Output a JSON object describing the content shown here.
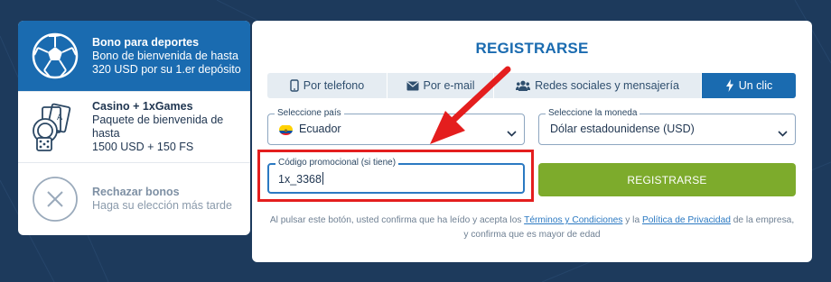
{
  "bonuses": {
    "sports": {
      "title": "Bono para deportes",
      "desc_line1": "Bono de bienvenida de hasta",
      "desc_line2": "320 USD por su 1.er depósito"
    },
    "casino": {
      "title": "Casino + 1xGames",
      "desc_line1": "Paquete de bienvenida de hasta",
      "desc_line2": "1500 USD + 150 FS"
    },
    "reject": {
      "title": "Rechazar bonos",
      "desc_line1": "Haga su elección más tarde"
    }
  },
  "register": {
    "title": "REGISTRARSE",
    "tabs": [
      {
        "label": "Por telefono",
        "icon": "phone-icon"
      },
      {
        "label": "Por e-mail",
        "icon": "envelope-icon"
      },
      {
        "label": "Redes sociales y mensajería",
        "icon": "users-icon"
      },
      {
        "label": "Un clic",
        "icon": "lightning-icon",
        "active": true
      }
    ],
    "country": {
      "label": "Seleccione país",
      "value": "Ecuador"
    },
    "currency": {
      "label": "Seleccione la moneda",
      "value": "Dólar estadounidense (USD)"
    },
    "promo": {
      "label": "Código promocional (si tiene)",
      "value": "1x_3368"
    },
    "submit_label": "REGISTRARSE",
    "legal": {
      "part1": "Al pulsar este botón, usted confirma que ha leído y acepta los",
      "terms": "Términos y Condiciones",
      "part2": "y la",
      "privacy": "Política de Privacidad",
      "part3": "de la empresa,",
      "part4": "y confirma que es mayor de edad"
    }
  },
  "colors": {
    "background": "#1d3a5c",
    "accent": "#1a6bb0",
    "button": "#7dab2c",
    "highlight": "#e41e1e"
  }
}
